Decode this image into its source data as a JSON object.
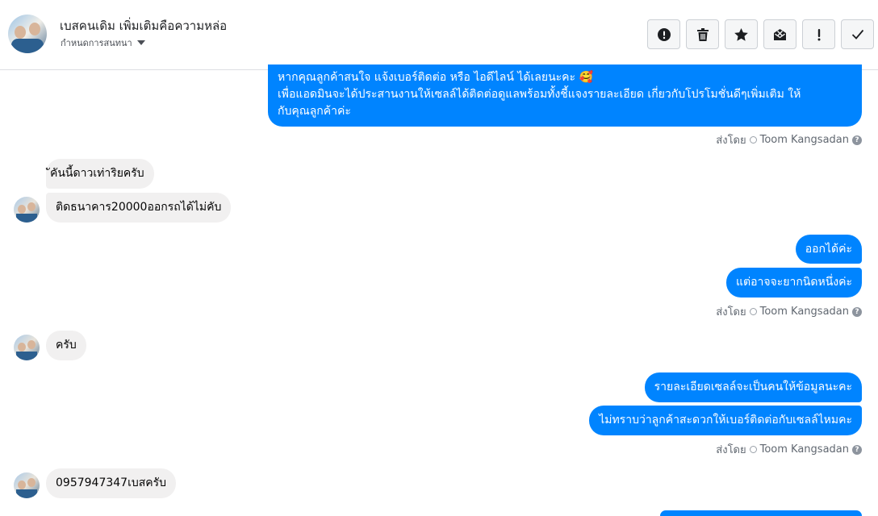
{
  "header": {
    "title": "เบสคนเดิม เพิ่มเติมคือความหล่อ",
    "subtitle": "กำหนดการสนทนา"
  },
  "toolbar": {
    "buttons": [
      {
        "name": "report",
        "icon": "exclamation-circle-icon"
      },
      {
        "name": "delete",
        "icon": "trash-icon"
      },
      {
        "name": "star",
        "icon": "star-icon"
      },
      {
        "name": "mark-unread",
        "icon": "envelope-x-icon"
      },
      {
        "name": "spam",
        "icon": "exclamation-icon"
      },
      {
        "name": "done",
        "icon": "check-icon"
      }
    ]
  },
  "messages": {
    "m1_line1": "หากคุณลูกค้าสนใจ แจ้งเบอร์ติดต่อ หรือ ไอดีไลน์ ได้เลยนะคะ 🥰",
    "m1_line2": "เพื่อแอดมินจะได้ประสานงานให้เซลล์ได้ติดต่อดูแลพร้อมทั้งชี้แจงรายละเอียด เกี่ยวกับโปรโมชั่นดีๆเพิ่มเติม ให้",
    "m1_line3": "กับคุณลูกค้าค่ะ",
    "in1": "ัคันนี้ดาวเท่าริยครับ",
    "in2": "ติดธนาคาร20000ออกรถได้ไม่คับ",
    "out2": "ออกได้ค่ะ",
    "out3": "แต่อาจจะยากนิดหนึ่งค่ะ",
    "in3": "ครับ",
    "out4": "รายละเอียดเซลล์จะเป็นคนให้ข้อมูลนะคะ",
    "out5": "ไม่ทราบว่าลูกค้าสะดวกให้เบอร์ติดต่อกับเซลล์ไหมคะ",
    "in4": "0957947347เบสครับ"
  },
  "sent_by": {
    "label": "ส่งโดย",
    "agent": "Toom Kangsadan"
  },
  "colors": {
    "outgoing": "#0084ff",
    "incoming": "#f1f0f0"
  }
}
